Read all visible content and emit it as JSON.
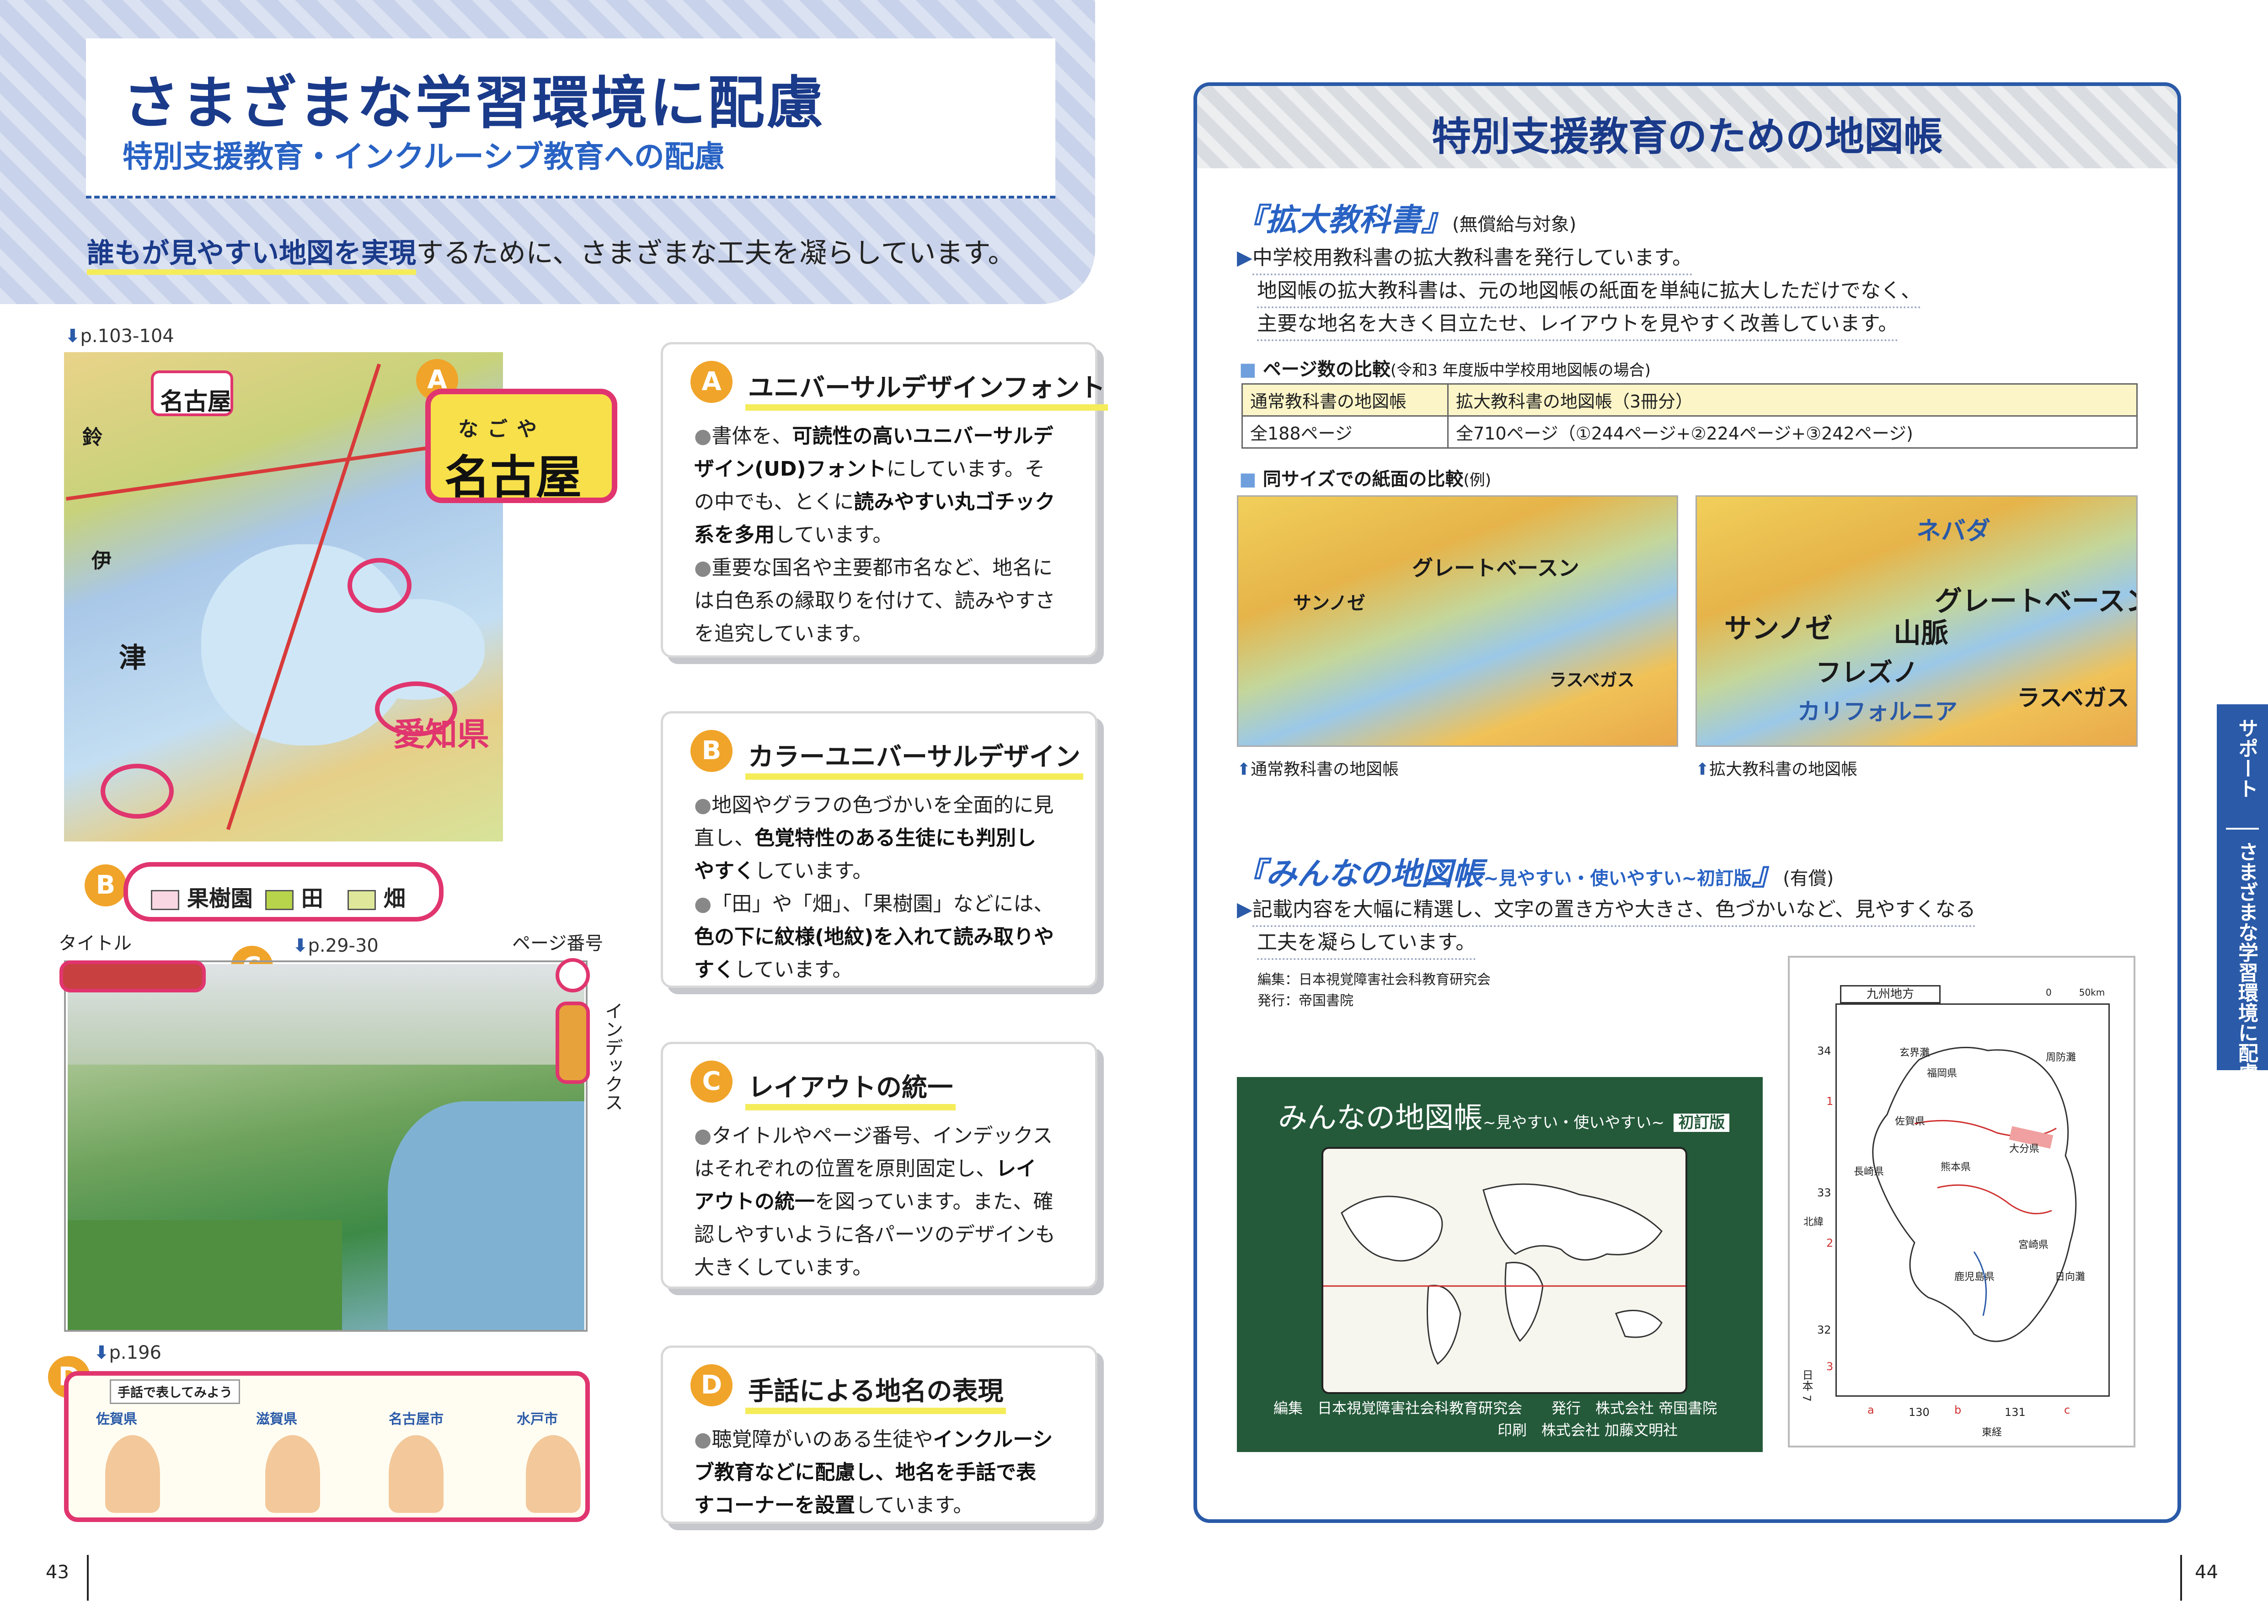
{
  "left": {
    "header": {
      "title": "さまざまな学習環境に配慮",
      "subtitle": "特別支援教育・インクルーシブ教育への配慮",
      "lead_bold": "誰もが見やすい地図を実現",
      "lead_rest": "するために、さまざまな工夫を凝らしています。"
    },
    "map1": {
      "page_ref": "p.103-104",
      "zoom_text": "名古屋",
      "zoom_furigana": "なごや",
      "city_label": "名古屋",
      "pref_label": "愛知県",
      "legend_badge": "B",
      "legend": [
        {
          "label": "果樹園",
          "color": "#f8d7e3"
        },
        {
          "label": "田",
          "color": "#b7d44a"
        },
        {
          "label": "畑",
          "color": "#dfe89a"
        }
      ],
      "badge": "A"
    },
    "map2": {
      "title_label": "タイトル",
      "page_label": "ページ番号",
      "index_label": "インデックス",
      "page_ref": "p.29-30",
      "badge": "C"
    },
    "sign": {
      "page_ref": "p.196",
      "badge": "D",
      "header_text": "手話で表してみよう",
      "places": [
        "佐賀県",
        "滋賀県",
        "名古屋市",
        "水戸市"
      ]
    },
    "cards": [
      {
        "badge": "A",
        "title": "ユニバーサルデザインフォント",
        "bullets": [
          [
            "書体を、",
            "可読性の高いユニバーサルデザイン(UD)フォント",
            "にしています。その中でも、とくに",
            "読みやすい丸ゴチック系を多用",
            "しています。"
          ],
          [
            "重要な国名や主要都市名など、地名には白色系の縁取りを付けて、読みやすさを追究しています。"
          ]
        ]
      },
      {
        "badge": "B",
        "title": "カラーユニバーサルデザイン",
        "bullets": [
          [
            "地図やグラフの色づかいを全面的に見直し、",
            "色覚特性のある生徒にも判別しやすく",
            "しています。"
          ],
          [
            "「田」や「畑」、「果樹園」などには、",
            "色の下に紋様(地紋)を入れて読み取りやすく",
            "しています。"
          ]
        ]
      },
      {
        "badge": "C",
        "title": "レイアウトの統一",
        "bullets": [
          [
            "タイトルやページ番号、インデックスはそれぞれの位置を原則固定し、",
            "レイアウトの統一",
            "を図っています。また、確認しやすいように各パーツのデザインも大きくしています。"
          ]
        ]
      },
      {
        "badge": "D",
        "title": "手話による地名の表現",
        "bullets": [
          [
            "聴覚障がいのある生徒や",
            "インクルーシブ教育などに配慮し、地名を手話で表すコーナーを設置",
            "しています。"
          ]
        ]
      }
    ],
    "page_number": "43"
  },
  "right": {
    "title": "特別支援教育のための地図帳",
    "sec1": {
      "title": "『拡大教科書』",
      "note": "(無償給与対象)",
      "lines": [
        "中学校用教科書の拡大教科書を発行しています。",
        "地図帳の拡大教科書は、元の地図帳の紙面を単純に拡大しただけでなく、",
        "主要な地名を大きく目立たせ、レイアウトを見やすく改善しています。"
      ]
    },
    "pages_compare": {
      "heading": "ページ数の比較",
      "heading_note": "(令和3 年度版中学校用地図帳の場合)",
      "rows": [
        [
          "通常教科書の地図帳",
          "拡大教科書の地図帳（3冊分）"
        ],
        [
          "全188ページ",
          "全710ページ（①244ページ+②224ページ+③242ページ)"
        ]
      ]
    },
    "size_compare": {
      "heading": "同サイズでの紙面の比較",
      "heading_note": "(例)",
      "caption_left": "通常教科書の地図帳",
      "caption_right": "拡大教科書の地図帳",
      "sample_labels": [
        "ネバダ",
        "グレートベースン",
        "サンノゼ",
        "フレズノ",
        "ラスベガス",
        "カリフォルニア",
        "山脈"
      ]
    },
    "sec2": {
      "title": "『みんなの地図帳",
      "title_small": "~見やすい・使いやすい~初訂版",
      "title_end": "』",
      "note": "(有償)",
      "lines": [
        "記載内容を大幅に精選し、文字の置き方や大きさ、色づかいなど、見やすくなる",
        "工夫を凝らしています。"
      ],
      "credits": [
        "編集：日本視覚障害社会科教育研究会",
        "発行：帝国書院"
      ]
    },
    "book": {
      "title": "みんなの地図帳",
      "subtitle": "~見やすい・使いやすい~",
      "edition": "初訂版",
      "credit_line1": "編集　日本視覚障害社会科教育研究会　　発行　株式会社 帝国書院",
      "credit_line2": "印刷　株式会社 加藤文明社"
    },
    "kyushu": {
      "title": "九州地方",
      "scale": "0　　　50km",
      "lat_labels": [
        "34",
        "33",
        "32"
      ],
      "lon_labels": [
        "130",
        "131"
      ],
      "grid_letters": [
        "a",
        "b",
        "c"
      ],
      "grid_numbers": [
        "1",
        "2",
        "3"
      ],
      "axis_north": "北緯",
      "axis_east": "東経",
      "places": [
        "福岡県",
        "佐賀県",
        "長崎県",
        "熊本県",
        "大分県",
        "宮崎県",
        "鹿児島県",
        "周防灘",
        "日向灘",
        "玄界灘"
      ],
      "side_text": "日本 7"
    },
    "side_tab": {
      "tab_label": "サポート",
      "tab_text": "さまざまな学習環境に配慮"
    },
    "page_number": "44"
  },
  "colors": {
    "brand_blue": "#2a5aa8",
    "title_navy": "#1a3a8a",
    "accent_pink": "#e0356e",
    "badge_orange": "#f0a42a",
    "highlight_yellow": "#f5ec5a",
    "book_green": "#245a3a"
  }
}
